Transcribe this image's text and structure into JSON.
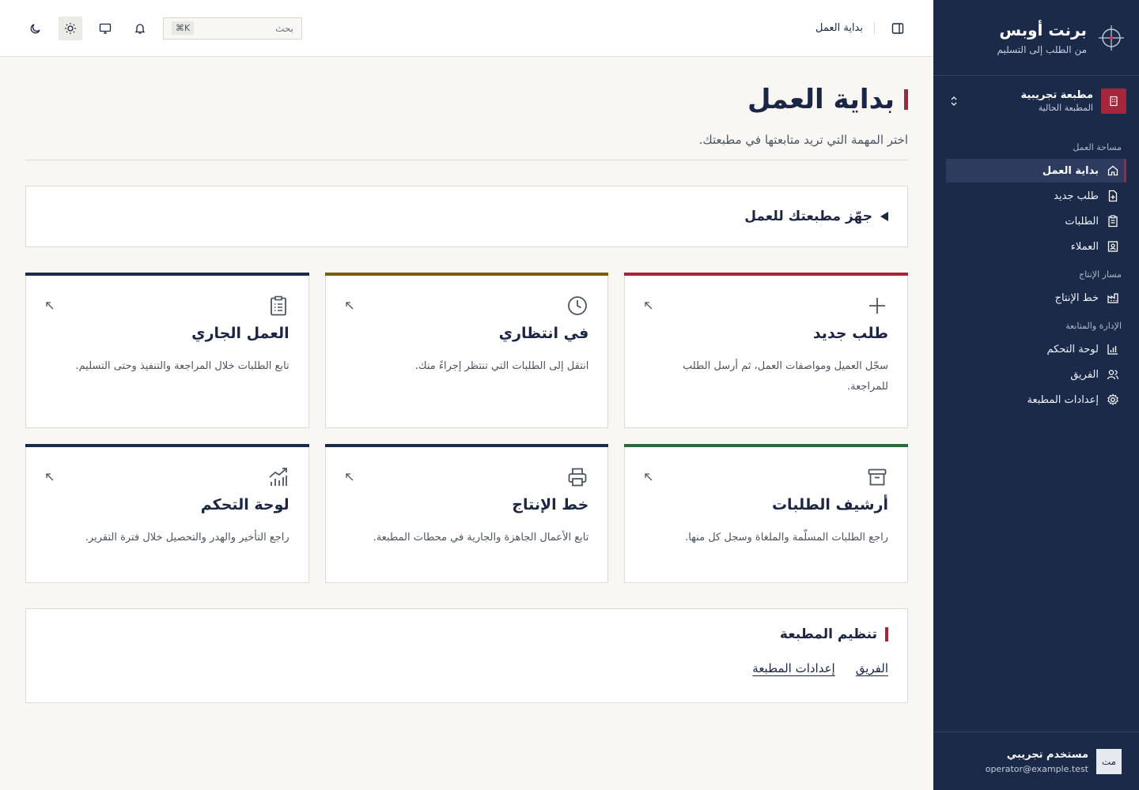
{
  "brand": {
    "name": "برنت أوبس",
    "tagline": "من الطلب إلى التسليم"
  },
  "org": {
    "name": "مطبعة تجريبية",
    "sub": "المطبعة الحالية"
  },
  "nav": {
    "workspace_heading": "مساحة العمل",
    "workspace": [
      "بداية العمل",
      "طلب جديد",
      "الطلبات",
      "العملاء"
    ],
    "production_heading": "مسار الإنتاج",
    "production": [
      "خط الإنتاج"
    ],
    "admin_heading": "الإدارة والمتابعة",
    "admin": [
      "لوحة التحكم",
      "الفريق",
      "إعدادات المطبعة"
    ]
  },
  "user": {
    "initials": "مت",
    "name": "مستخدم تجريبي",
    "email": "operator@example.test"
  },
  "header": {
    "breadcrumb": "بداية العمل",
    "search_placeholder": "بحث",
    "shortcut": "⌘K"
  },
  "page": {
    "title": "بداية العمل",
    "subtitle": "اختر المهمة التي تريد متابعتها في مطبعتك.",
    "setup_title": "جهّز مطبعتك للعمل"
  },
  "cards": [
    {
      "title": "طلب جديد",
      "desc": "سجّل العميل ومواصفات العمل، ثم أرسل الطلب للمراجعة.",
      "icon": "plus-icon",
      "accent": "#a3263a"
    },
    {
      "title": "في انتظاري",
      "desc": "انتقل إلى الطلبات التي تنتظر إجراءً منك.",
      "icon": "clock-icon",
      "accent": "#7a5f10"
    },
    {
      "title": "العمل الجاري",
      "desc": "تابع الطلبات خلال المراجعة والتنفيذ وحتى التسليم.",
      "icon": "clipboard-icon",
      "accent": "#1c2a4a"
    },
    {
      "title": "أرشيف الطلبات",
      "desc": "راجع الطلبات المسلّمة والملغاة وسجل كل منها.",
      "icon": "archive-icon",
      "accent": "#2e6b3c"
    },
    {
      "title": "خط الإنتاج",
      "desc": "تابع الأعمال الجاهزة والجارية في محطات المطبعة.",
      "icon": "printer-icon",
      "accent": "#1c2a4a"
    },
    {
      "title": "لوحة التحكم",
      "desc": "راجع التأخير والهدر والتحصيل خلال فترة التقرير.",
      "icon": "chart-icon",
      "accent": "#1c2a4a"
    }
  ],
  "organization": {
    "title": "تنظيم المطبعة",
    "links": [
      "الفريق",
      "إعدادات المطبعة"
    ]
  },
  "colors": {
    "sidebar": "#1c2a4a",
    "accent": "#a3263a",
    "background": "#f8f7f3"
  }
}
